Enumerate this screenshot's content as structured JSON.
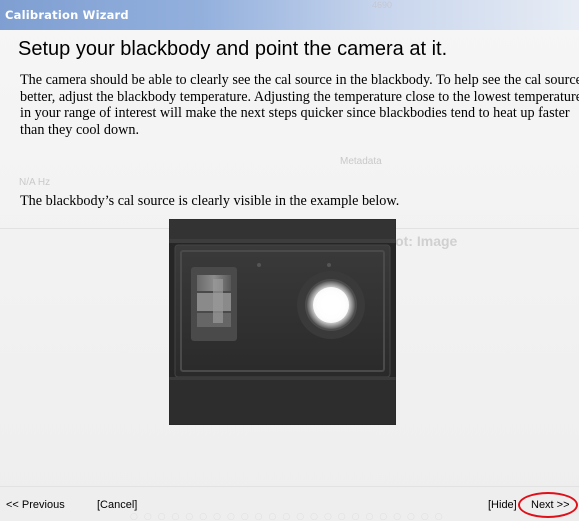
{
  "window": {
    "title": "Calibration Wizard",
    "background_app_text": {
      "top": "4690",
      "metadata": "Metadata",
      "rate": "N/A Hz",
      "plot_title": "Temporal Plot: Image"
    }
  },
  "step": {
    "heading": "Setup your blackbody and point the camera at it.",
    "paragraph1": "The camera should be able to clearly see the cal source in the blackbody.  To help see the cal source better, adjust the blackbody temperature.  Adjusting the temperature close to the lowest temperature in your range of interest will make the next steps quicker since blackbodies tend to heat up faster than they cool down.",
    "paragraph2": "The blackbody’s cal source is clearly visible in the example below.",
    "example_image": "thermal camera view of blackbody with bright circular cal source"
  },
  "footer": {
    "previous": "<< Previous",
    "cancel": "[Cancel]",
    "hide": "[Hide]",
    "next": "Next >>"
  },
  "colors": {
    "titlebar_start": "#7f9fd2",
    "titlebar_end": "#e8edf5",
    "highlight_circle": "#e0101a"
  }
}
